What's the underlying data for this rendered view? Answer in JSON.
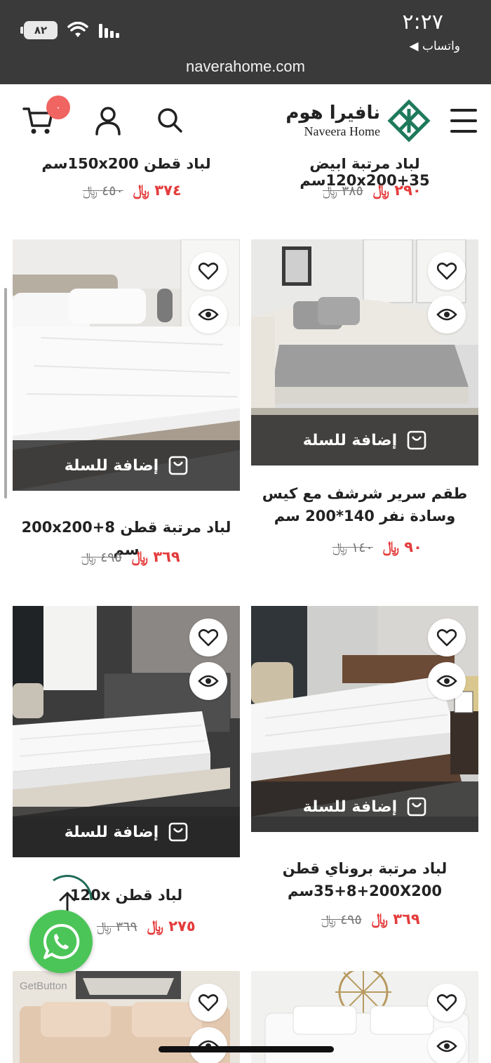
{
  "status_bar": {
    "time": "٢:٢٧",
    "back_app": "◀ واتساب",
    "battery": "٨٢",
    "url": "naverahome.com"
  },
  "header": {
    "logo_ar": "نافيرا هوم",
    "logo_en": "Naveera Home",
    "cart_count": "٠"
  },
  "partial_row": [
    {
      "title": "لباد مرتبة أبيض 35+120x200سم",
      "price": "٢٩٠",
      "old_price": "٣٨٥"
    },
    {
      "title": "لباد قطن 150x200سم",
      "price": "٣٧٤",
      "old_price": "٤٥٠"
    }
  ],
  "products": [
    {
      "title_lines": [
        "طقم سرير شرشف مع كيس",
        "وسادة نفر 140*200 سم"
      ],
      "price": "٩٠",
      "old_price": "١٤٠",
      "add_label": "إضافة للسلة"
    },
    {
      "title_lines": [
        "لباد مرتبة قطن 8+200x200 سم"
      ],
      "price": "٣٦٩",
      "old_price": "٤٩٥",
      "add_label": "إضافة للسلة"
    },
    {
      "title_lines": [
        "لباد مرتبة بروناي قطن",
        "35+8+200X200سم"
      ],
      "price": "٣٦٩",
      "old_price": "٤٩٥",
      "add_label": "إضافة للسلة"
    },
    {
      "title_lines": [
        "لباد قطن 120x"
      ],
      "price": "٢٧٥",
      "old_price": "٣٦٩",
      "add_label": "إضافة للسلة"
    }
  ],
  "currency_symbol": "﷼",
  "floating": {
    "getbutton": "GetButton"
  },
  "icons": [
    "menu-icon",
    "search-icon",
    "user-icon",
    "cart-icon",
    "heart-icon",
    "eye-icon",
    "bag-icon",
    "whatsapp-icon",
    "arrow-up-icon"
  ]
}
